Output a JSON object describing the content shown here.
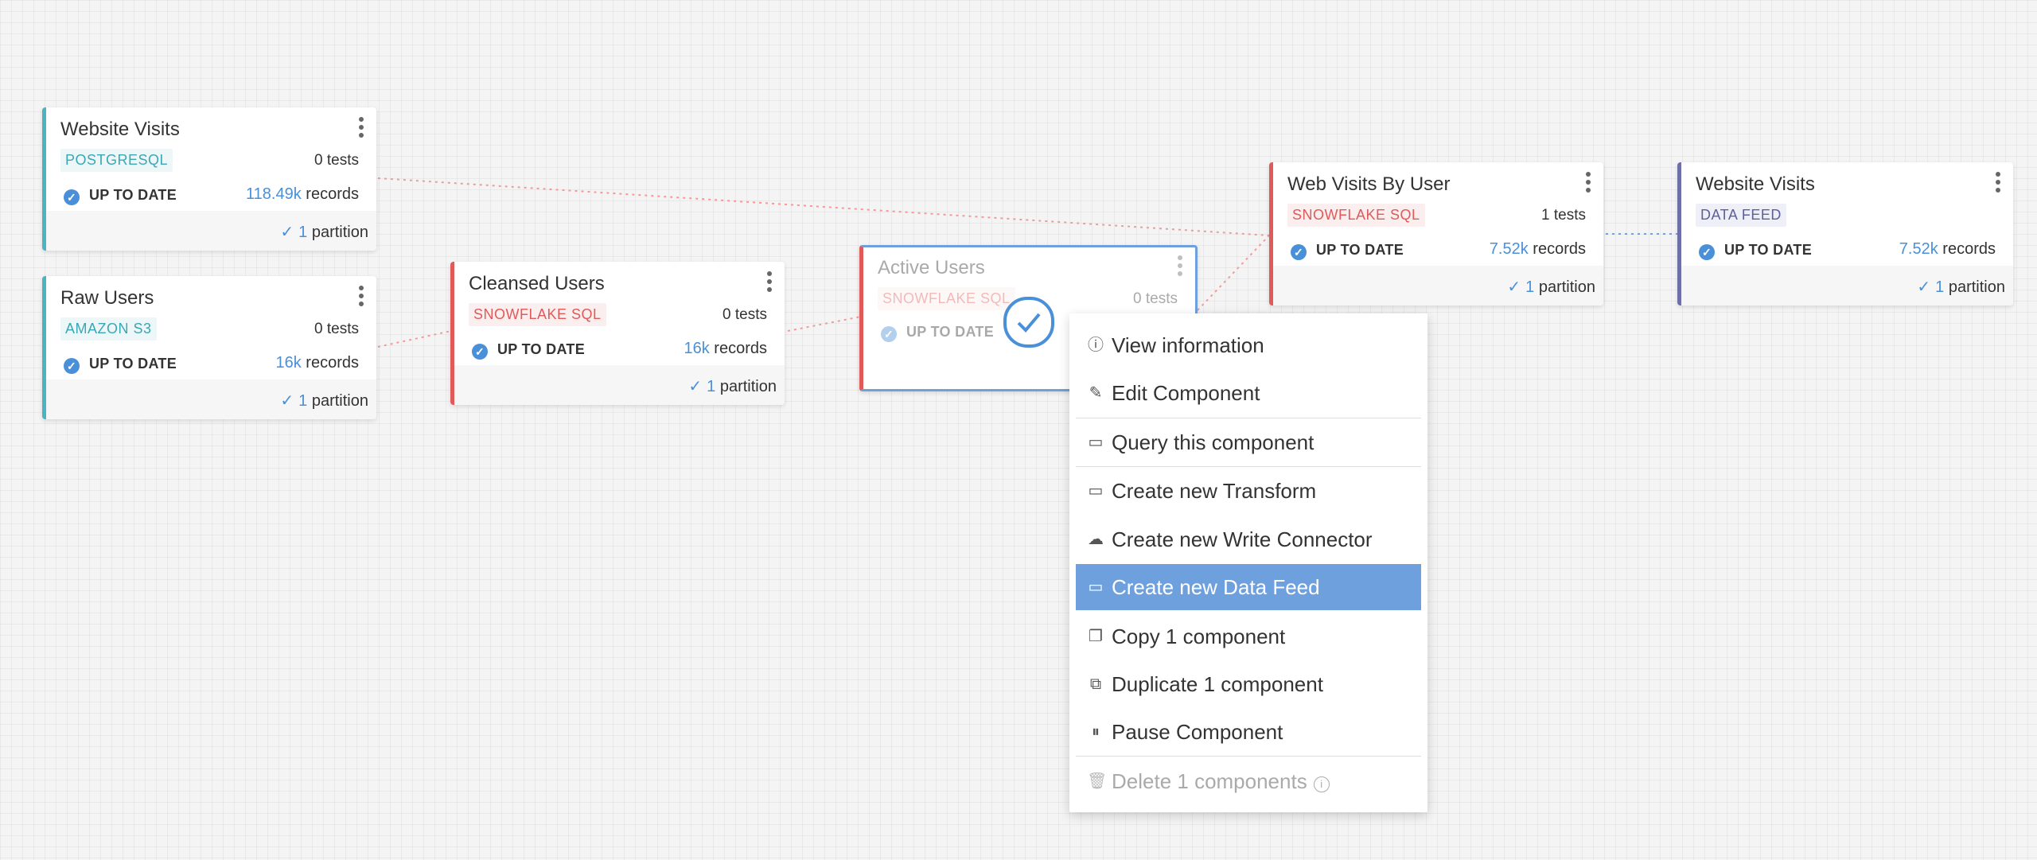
{
  "nodes": {
    "website_visits_src": {
      "title": "Website Visits",
      "connector": "POSTGRESQL",
      "tests": "0 tests",
      "status": "UP TO DATE",
      "records_num": "118.49k",
      "records_label": "records",
      "partition_num": "1",
      "partition_label": "partition"
    },
    "raw_users": {
      "title": "Raw Users",
      "connector": "AMAZON S3",
      "tests": "0 tests",
      "status": "UP TO DATE",
      "records_num": "16k",
      "records_label": "records",
      "partition_num": "1",
      "partition_label": "partition"
    },
    "cleansed_users": {
      "title": "Cleansed Users",
      "connector": "SNOWFLAKE SQL",
      "tests": "0 tests",
      "status": "UP TO DATE",
      "records_num": "16k",
      "records_label": "records",
      "partition_num": "1",
      "partition_label": "partition"
    },
    "active_users": {
      "title": "Active Users",
      "connector": "SNOWFLAKE SQL",
      "tests": "0 tests",
      "status": "UP TO DATE"
    },
    "web_visits_by_user": {
      "title": "Web Visits By User",
      "connector": "SNOWFLAKE SQL",
      "tests": "1 tests",
      "status": "UP TO DATE",
      "records_num": "7.52k",
      "records_label": "records",
      "partition_num": "1",
      "partition_label": "partition"
    },
    "website_visits_feed": {
      "title": "Website Visits",
      "connector": "DATA FEED",
      "status": "UP TO DATE",
      "records_num": "7.52k",
      "records_label": "records",
      "partition_num": "1",
      "partition_label": "partition"
    }
  },
  "context_menu": {
    "view_information": "View information",
    "edit_component": "Edit Component",
    "query_component": "Query this component",
    "create_transform": "Create new Transform",
    "create_write_connector": "Create new Write Connector",
    "create_data_feed": "Create new Data Feed",
    "copy_component": "Copy 1 component",
    "duplicate_component": "Duplicate 1 component",
    "pause_component": "Pause Component",
    "delete_components": "Delete 1 components"
  },
  "colors": {
    "postgres_accent": "#4bb4c0",
    "snowflake_accent": "#e05a5a",
    "data_feed_accent": "#6d6fa8",
    "highlight": "#6fa0de",
    "link_blue": "#4a90d9"
  },
  "icons": {
    "info": "info-circle-icon",
    "edit": "pencil-icon",
    "query": "table-window-icon",
    "transform": "table-window-icon",
    "write": "cloud-upload-icon",
    "feed": "table-window-icon",
    "copy": "copy-icon",
    "duplicate": "duplicate-icon",
    "pause": "pause-circle-icon",
    "delete": "trash-icon"
  }
}
